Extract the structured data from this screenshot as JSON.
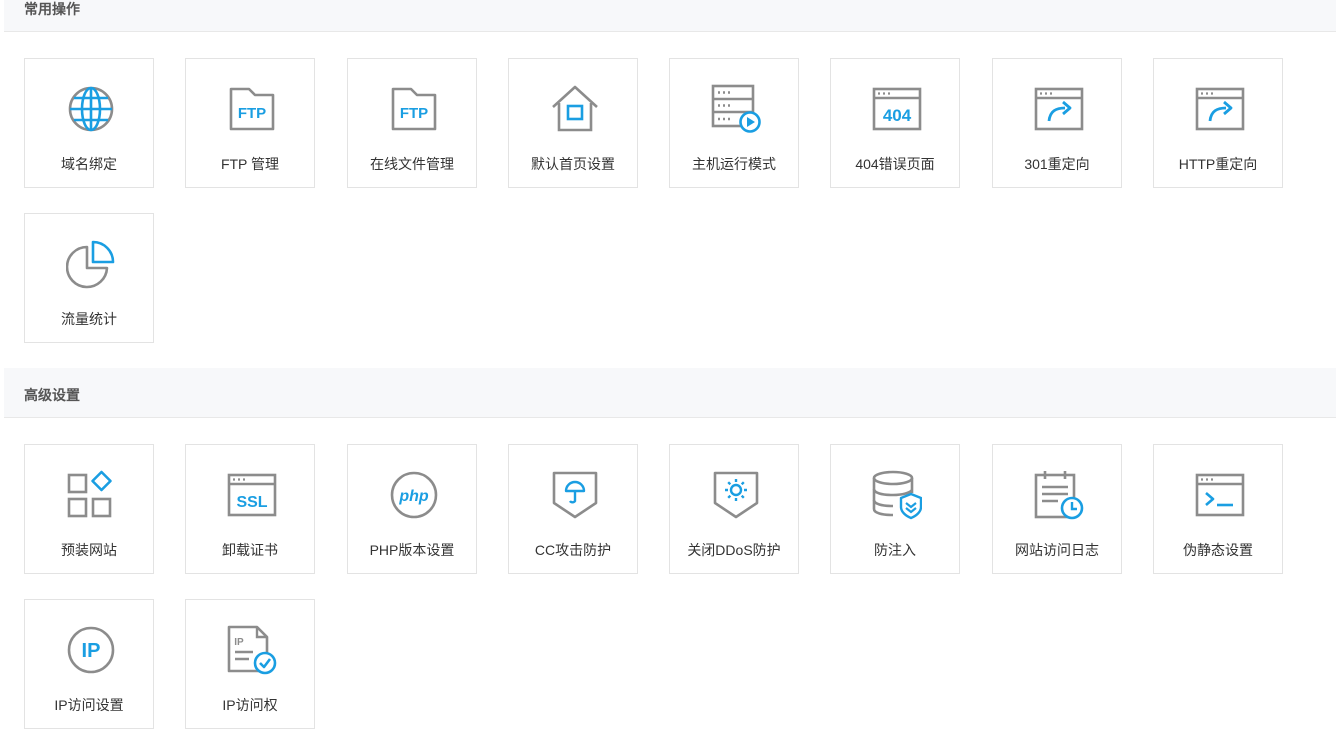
{
  "sections": [
    {
      "title": "常用操作",
      "items": [
        {
          "label": "域名绑定",
          "icon": "globe-icon"
        },
        {
          "label": "FTP 管理",
          "icon": "ftp-folder-icon",
          "icon_text": "FTP"
        },
        {
          "label": "在线文件管理",
          "icon": "ftp-folder-icon",
          "icon_text": "FTP"
        },
        {
          "label": "默认首页设置",
          "icon": "home-icon"
        },
        {
          "label": "主机运行模式",
          "icon": "server-play-icon"
        },
        {
          "label": "404错误页面",
          "icon": "browser-404-icon",
          "icon_text": "404"
        },
        {
          "label": "301重定向",
          "icon": "browser-redirect-icon"
        },
        {
          "label": "HTTP重定向",
          "icon": "browser-redirect-icon"
        },
        {
          "label": "流量统计",
          "icon": "pie-chart-icon"
        }
      ]
    },
    {
      "title": "高级设置",
      "items": [
        {
          "label": "预装网站",
          "icon": "apps-grid-icon"
        },
        {
          "label": "卸载证书",
          "icon": "browser-ssl-icon",
          "icon_text": "SSL"
        },
        {
          "label": "PHP版本设置",
          "icon": "php-icon",
          "icon_text": "php"
        },
        {
          "label": "CC攻击防护",
          "icon": "shield-umbrella-icon"
        },
        {
          "label": "关闭DDoS防护",
          "icon": "shield-gear-icon"
        },
        {
          "label": "防注入",
          "icon": "database-shield-icon"
        },
        {
          "label": "网站访问日志",
          "icon": "calendar-clock-icon"
        },
        {
          "label": "伪静态设置",
          "icon": "terminal-icon"
        },
        {
          "label": "IP访问设置",
          "icon": "ip-circle-icon",
          "icon_text": "IP"
        },
        {
          "label": "IP访问权",
          "icon": "ip-document-check-icon",
          "icon_text": "IP"
        }
      ]
    }
  ],
  "colors": {
    "accent": "#1a9ee2",
    "icon_gray": "#8c8c8c",
    "tile_border": "#e3e3e3",
    "header_bg": "#f7f8fa"
  }
}
